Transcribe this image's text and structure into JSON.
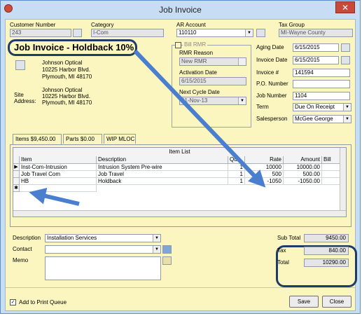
{
  "window": {
    "title": "Job Invoice",
    "close_glyph": "✕"
  },
  "header": {
    "customer_number_label": "Customer Number",
    "customer_number": "243",
    "category_label": "Category",
    "category": "I-Com",
    "ar_account_label": "AR Account",
    "ar_account": "110110",
    "tax_group_label": "Tax Group",
    "tax_group": "MI-Wayne County"
  },
  "heading": "Job Invoice - Holdback 10%",
  "customer": {
    "name": "Johnson Optical",
    "address1": "10225 Harbor Blvd.",
    "address2": "Plymouth, MI  48170",
    "site_label": "Site",
    "site_address_label": "Address:",
    "site_name": "Johnson Optical",
    "site_address1": "10225 Harbor Blvd.",
    "site_address2": "Plymouth, MI  48170"
  },
  "rmr": {
    "bill_rmr_label": "Bill RMR",
    "rmr_reason_label": "RMR Reason",
    "rmr_reason": "New RMR",
    "activation_date_label": "Activation Date",
    "activation_date": "6/15/2015",
    "next_cycle_label": "Next Cycle Date",
    "next_cycle": "01-Nov-13"
  },
  "invoice": {
    "aging_date_label": "Aging Date",
    "aging_date": "6/15/2015",
    "invoice_date_label": "Invoice Date",
    "invoice_date": "6/15/2015",
    "invoice_no_label": "Invoice #",
    "invoice_no": "141594",
    "po_label": "P.O. Number",
    "po": "",
    "job_number_label": "Job Number",
    "job_number": "1104",
    "term_label": "Term",
    "term": "Due On Receipt",
    "salesperson_label": "Salesperson",
    "salesperson": "McGee George"
  },
  "tabs": [
    {
      "label": "Items  $9,450.00"
    },
    {
      "label": "Parts  $0.00"
    },
    {
      "label": "WIP MLOC"
    }
  ],
  "grid": {
    "caption": "Item List",
    "columns": [
      "Item",
      "Description",
      "Qu",
      "Rate",
      "Amount",
      "Bill Cycle"
    ],
    "rows": [
      {
        "item": "Inst-Com-Intrusion",
        "description": "Intrusion System Pre-wire",
        "qty": "1",
        "rate": "10000",
        "amount": "10000.00",
        "bill_cycle": ""
      },
      {
        "item": "Job Travel Com",
        "description": "Job Travel",
        "qty": "1",
        "rate": "500",
        "amount": "500.00",
        "bill_cycle": ""
      },
      {
        "item": "HB",
        "description": "Holdback",
        "qty": "1",
        "rate": "-1050",
        "amount": "-1050.00",
        "bill_cycle": ""
      }
    ],
    "row_marker_current": "▶",
    "row_marker_new": "✱"
  },
  "footer": {
    "description_label": "Description",
    "description": "Installation Services",
    "contact_label": "Contact",
    "contact": "",
    "memo_label": "Memo",
    "memo": "",
    "subtotal_label": "Sub Total",
    "subtotal": "9450.00",
    "tax_label": "Tax",
    "tax": "840.00",
    "total_label": "Total",
    "total": "10290.00",
    "print_queue_label": "Add to Print Queue",
    "print_queue_checked": "✓",
    "save_label": "Save",
    "close_label": "Close"
  },
  "colors": {
    "form_bg": "#fbf6bf",
    "annotation": "#1f3c68",
    "arrow": "#4a7fd0"
  }
}
